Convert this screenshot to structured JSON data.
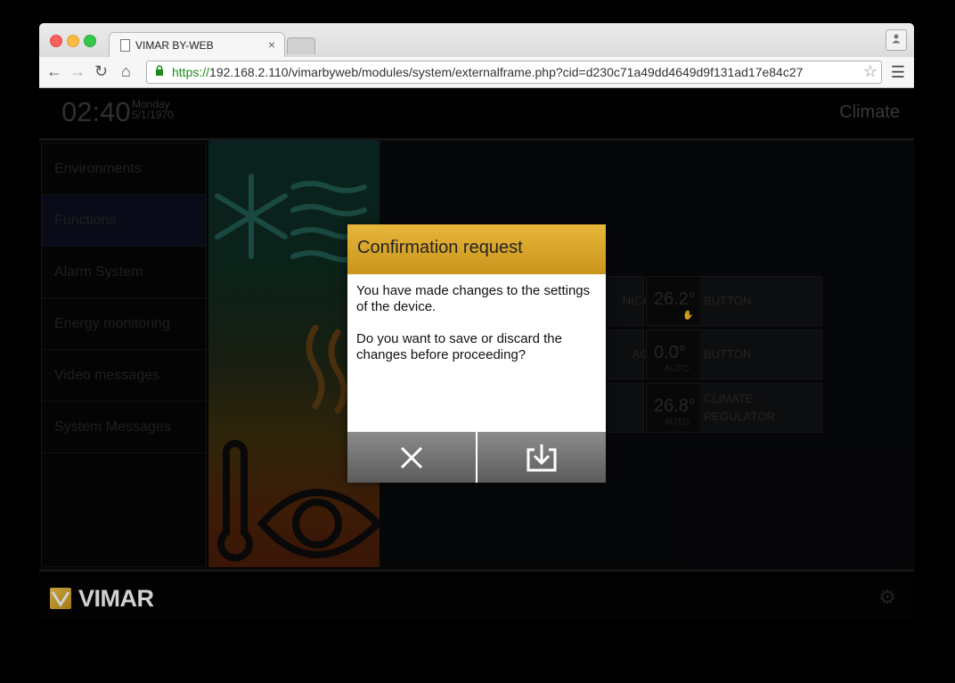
{
  "browser": {
    "tab_title": "VIMAR BY-WEB",
    "tab_close": "×",
    "url_scheme": "https://",
    "url_rest": "192.168.2.110/vimarbyweb/modules/system/externalframe.php?cid=d230c71a49dd4649d9f131ad17e84c27",
    "icons": [
      "back-arrow-icon",
      "forward-arrow-icon",
      "reload-icon",
      "home-icon",
      "lock-icon",
      "star-icon",
      "hamburger-menu-icon",
      "user-icon"
    ]
  },
  "header": {
    "time": "02:40",
    "weekday": "Monday",
    "date": "5/1/1970",
    "section": "Climate"
  },
  "sidebar": {
    "items": [
      {
        "label": "Environments"
      },
      {
        "label": "Functions"
      },
      {
        "label": "Alarm System"
      },
      {
        "label": "Energy monitoring"
      },
      {
        "label": "Video messages"
      },
      {
        "label": "System Messages"
      }
    ]
  },
  "tiles": {
    "left": [
      {
        "label": "NICAL"
      },
      {
        "label": "AGE"
      }
    ],
    "right": [
      {
        "value": "26.2°",
        "mode": "",
        "label": "BUTTON"
      },
      {
        "value": "0.0°",
        "mode": "AUTO",
        "label": "BUTTON"
      },
      {
        "value": "26.8°",
        "mode": "AUTO",
        "label": "CLIMATE REGULATOR"
      }
    ]
  },
  "footer": {
    "brand": "VIMAR"
  },
  "dialog": {
    "title": "Confirmation request",
    "line1": "You have made changes to the settings of the device.",
    "line2": "Do you want to save or discard the changes before proceeding?",
    "discard_icon": "close-x-icon",
    "save_icon": "download-save-icon"
  },
  "colors": {
    "dialog_header": "#d9a52b",
    "button_gray": "#737373",
    "url_green": "#1a8a1a"
  }
}
